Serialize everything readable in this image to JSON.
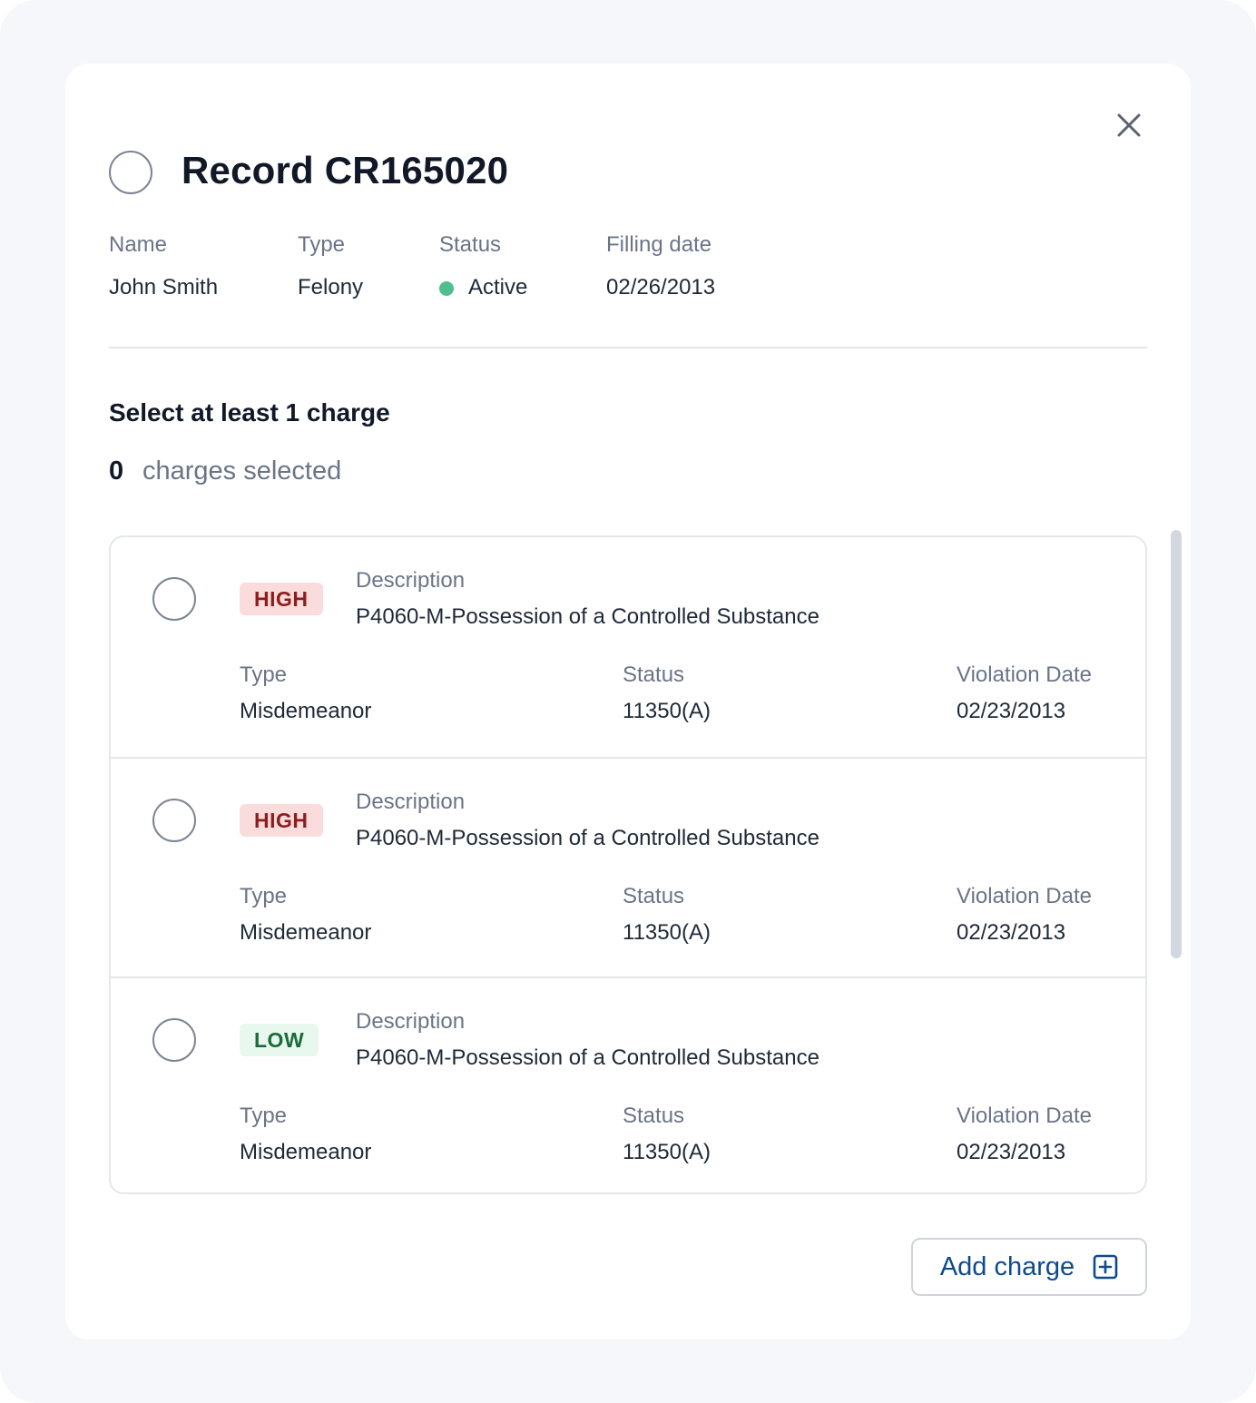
{
  "header": {
    "title": "Record CR165020",
    "close_icon": "close-icon"
  },
  "record": {
    "name_label": "Name",
    "name_value": "John Smith",
    "type_label": "Type",
    "type_value": "Felony",
    "status_label": "Status",
    "status_value": "Active",
    "status_color": "#4fbf8e",
    "date_label": "Filling date",
    "date_value": "02/26/2013"
  },
  "selection": {
    "title": "Select at least 1 charge",
    "count": "0",
    "count_text": "charges selected"
  },
  "charges": [
    {
      "severity": "HIGH",
      "description_label": "Description",
      "description": "P4060-M-Possession of a Controlled Substance",
      "type_label": "Type",
      "type": "Misdemeanor",
      "status_label": "Status",
      "status": "11350(A)",
      "date_label": "Violation Date",
      "date": "02/23/2013"
    },
    {
      "severity": "HIGH",
      "description_label": "Description",
      "description": "P4060-M-Possession of a Controlled Substance",
      "type_label": "Type",
      "type": "Misdemeanor",
      "status_label": "Status",
      "status": "11350(A)",
      "date_label": "Violation Date",
      "date": "02/23/2013"
    },
    {
      "severity": "LOW",
      "description_label": "Description",
      "description": "P4060-M-Possession of a Controlled Substance",
      "type_label": "Type",
      "type": "Misdemeanor",
      "status_label": "Status",
      "status": "11350(A)",
      "date_label": "Violation Date",
      "date": "02/23/2013"
    }
  ],
  "actions": {
    "add_charge_label": "Add charge",
    "add_icon": "plus-square-icon"
  },
  "colors": {
    "accent": "#0e4a8f",
    "high_bg": "#fbdcdc",
    "high_text": "#8e1d1d",
    "low_bg": "#e9f8ef",
    "low_text": "#1a6b3a"
  }
}
